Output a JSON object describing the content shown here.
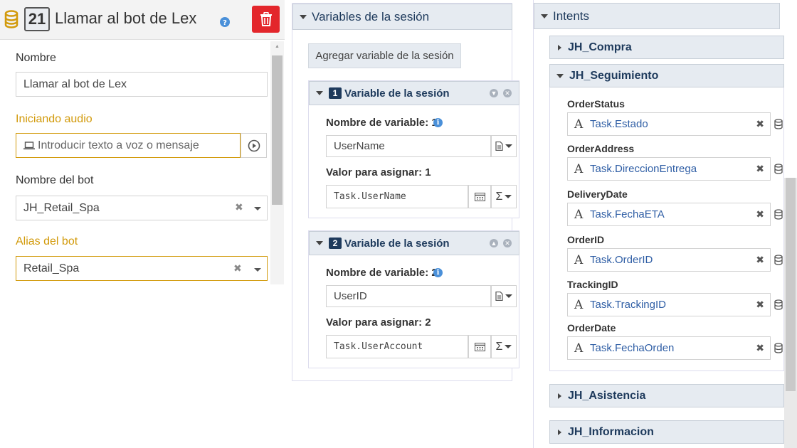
{
  "step": {
    "number": "21",
    "title": "Llamar al bot de Lex"
  },
  "left": {
    "name_label": "Nombre",
    "name_value": "Llamar al bot de Lex",
    "audio_label": "Iniciando audio",
    "audio_placeholder": "Introducir texto a voz o mensaje",
    "bot_name_label": "Nombre del bot",
    "bot_name_value": "JH_Retail_Spa",
    "bot_alias_label": "Alias del bot",
    "bot_alias_value": "Retail_Spa"
  },
  "session": {
    "section_title": "Variables de la sesión",
    "add_button": "Agregar variable de la sesión",
    "variables": [
      {
        "index": "1",
        "title": "Variable de la sesión",
        "name_label": "Nombre de variable: 1",
        "name_value": "UserName",
        "value_label": "Valor para asignar: 1",
        "value_value": "Task.UserName"
      },
      {
        "index": "2",
        "title": "Variable de la sesión",
        "name_label": "Nombre de variable: 2",
        "name_value": "UserID",
        "value_label": "Valor para asignar: 2",
        "value_value": "Task.UserAccount"
      }
    ]
  },
  "intents": {
    "section_title": "Intents",
    "items": [
      {
        "name": "JH_Compra",
        "expanded": false
      },
      {
        "name": "JH_Seguimiento",
        "expanded": true
      },
      {
        "name": "JH_Asistencia",
        "expanded": false
      },
      {
        "name": "JH_Informacion",
        "expanded": false
      }
    ],
    "slots": [
      {
        "label": "OrderStatus",
        "value": "Task.Estado"
      },
      {
        "label": "OrderAddress",
        "value": "Task.DireccionEntrega"
      },
      {
        "label": "DeliveryDate",
        "value": "Task.FechaETA"
      },
      {
        "label": "OrderID",
        "value": "Task.OrderID"
      },
      {
        "label": "TrackingID",
        "value": "Task.TrackingID"
      },
      {
        "label": "OrderDate",
        "value": "Task.FechaOrden"
      }
    ]
  },
  "colors": {
    "accent_gold": "#d29a0b",
    "delete_red": "#e3262b",
    "header_navy": "#1e3a5c",
    "link_blue": "#2f5ea5"
  },
  "icons": [
    "database-icon",
    "help-icon",
    "trash-icon",
    "laptop-icon",
    "play-icon",
    "info-icon",
    "document-icon",
    "calculator-icon",
    "sigma-icon",
    "text-type-icon",
    "clear-icon",
    "chevron-down-icon"
  ]
}
